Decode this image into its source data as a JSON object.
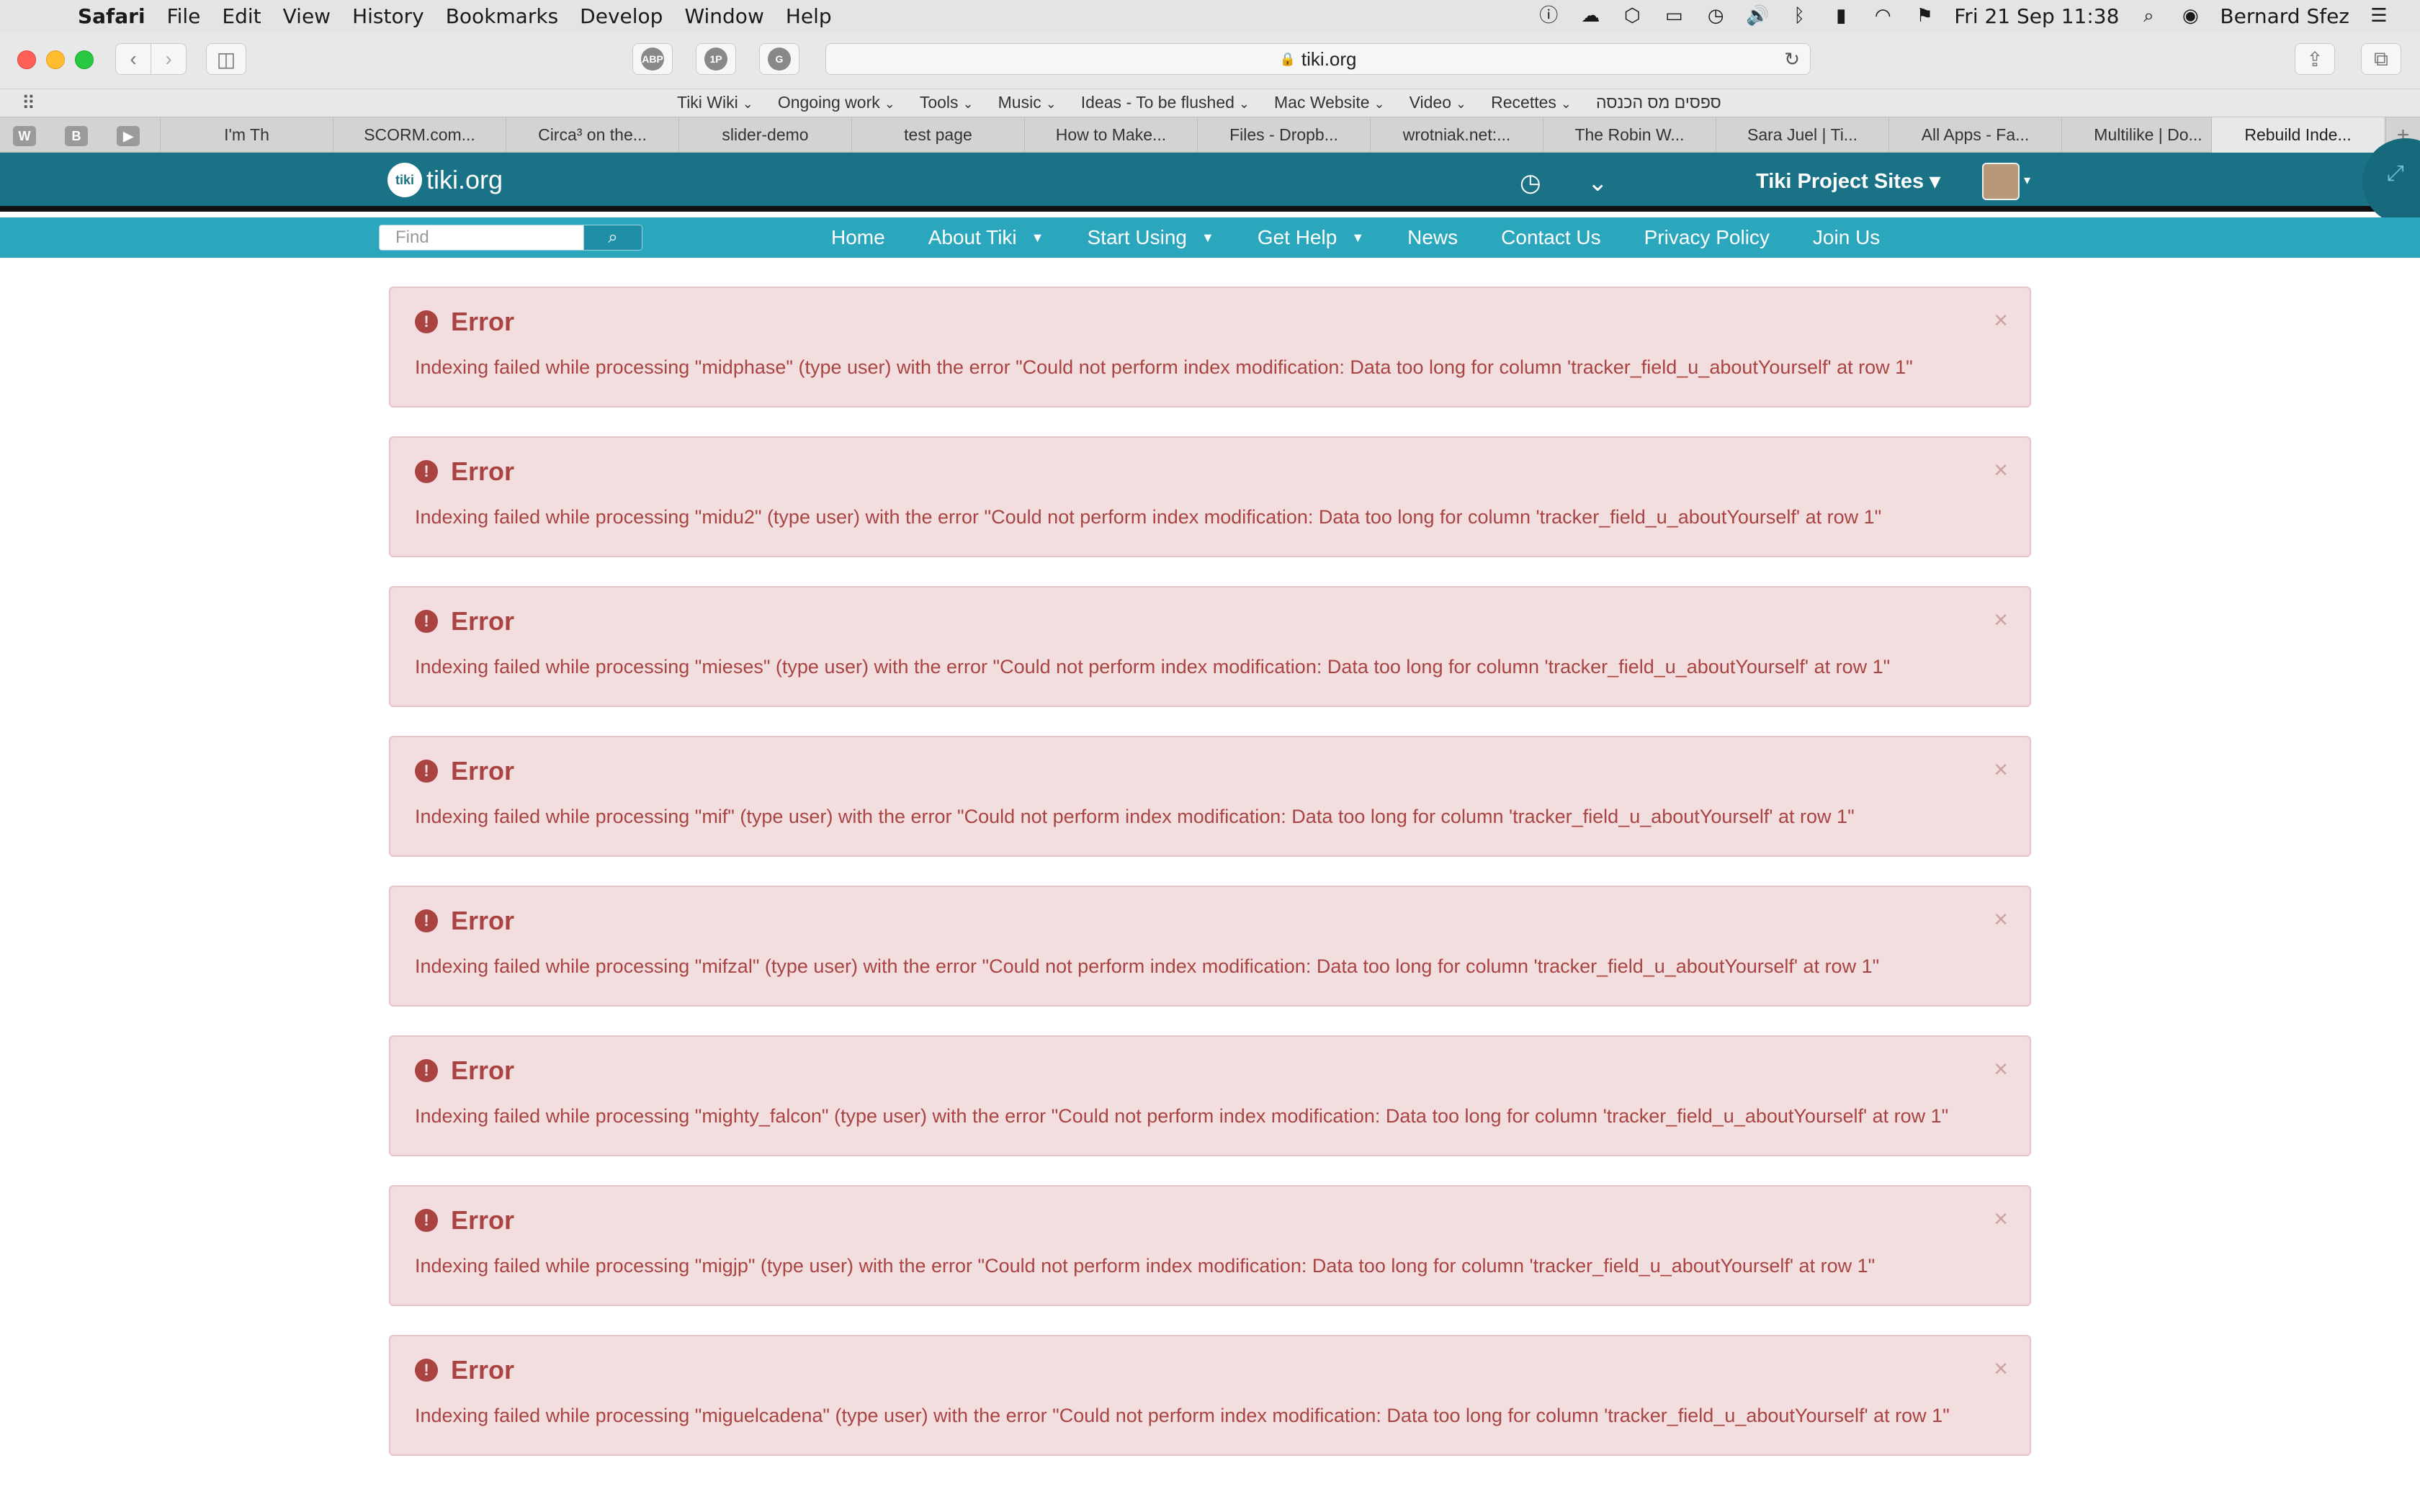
{
  "menubar": {
    "app": "Safari",
    "items": [
      "File",
      "Edit",
      "View",
      "History",
      "Bookmarks",
      "Develop",
      "Window",
      "Help"
    ],
    "datetime": "Fri 21 Sep  11:38",
    "user": "Bernard Sfez"
  },
  "toolbar": {
    "url": "tiki.org",
    "extensions": [
      "ABP",
      "1P",
      "G"
    ]
  },
  "favorites": [
    "Tiki Wiki",
    "Ongoing work",
    "Tools",
    "Music",
    "Ideas - To be flushed",
    "Mac Website",
    "Video",
    "Recettes",
    "ספסים מס הכנסה"
  ],
  "tabs": {
    "pinned": [
      "W",
      "B",
      "▶"
    ],
    "list": [
      "I'm Th",
      "SCORM.com...",
      "Circa³ on the...",
      "slider-demo",
      "test page",
      "How to Make...",
      "Files - Dropb...",
      "wrotniak.net:...",
      "The Robin W...",
      "Sara Juel | Ti...",
      "All Apps - Fa...",
      "Multilike | Do...",
      "Rebuild Inde..."
    ],
    "active_index": 12
  },
  "site": {
    "logo_mark": "tiki",
    "logo_text": "tiki.org",
    "project_sites": "Tiki Project Sites",
    "search_placeholder": "Find",
    "nav": [
      {
        "label": "Home",
        "dropdown": false
      },
      {
        "label": "About Tiki",
        "dropdown": true
      },
      {
        "label": "Start Using",
        "dropdown": true
      },
      {
        "label": "Get Help",
        "dropdown": true
      },
      {
        "label": "News",
        "dropdown": false
      },
      {
        "label": "Contact Us",
        "dropdown": false
      },
      {
        "label": "Privacy Policy",
        "dropdown": false
      },
      {
        "label": "Join Us",
        "dropdown": false
      }
    ]
  },
  "errors": [
    {
      "title": "Error",
      "message": "Indexing failed while processing \"midphase\" (type user) with the error \"Could not perform index modification: Data too long for column 'tracker_field_u_aboutYourself' at row 1\""
    },
    {
      "title": "Error",
      "message": "Indexing failed while processing \"midu2\" (type user) with the error \"Could not perform index modification: Data too long for column 'tracker_field_u_aboutYourself' at row 1\""
    },
    {
      "title": "Error",
      "message": "Indexing failed while processing \"mieses\" (type user) with the error \"Could not perform index modification: Data too long for column 'tracker_field_u_aboutYourself' at row 1\""
    },
    {
      "title": "Error",
      "message": "Indexing failed while processing \"mif\" (type user) with the error \"Could not perform index modification: Data too long for column 'tracker_field_u_aboutYourself' at row 1\""
    },
    {
      "title": "Error",
      "message": "Indexing failed while processing \"mifzal\" (type user) with the error \"Could not perform index modification: Data too long for column 'tracker_field_u_aboutYourself' at row 1\""
    },
    {
      "title": "Error",
      "message": "Indexing failed while processing \"mighty_falcon\" (type user) with the error \"Could not perform index modification: Data too long for column 'tracker_field_u_aboutYourself' at row 1\""
    },
    {
      "title": "Error",
      "message": "Indexing failed while processing \"migjp\" (type user) with the error \"Could not perform index modification: Data too long for column 'tracker_field_u_aboutYourself' at row 1\""
    },
    {
      "title": "Error",
      "message": "Indexing failed while processing \"miguelcadena\" (type user) with the error \"Could not perform index modification: Data too long for column 'tracker_field_u_aboutYourself' at row 1\""
    }
  ],
  "icons": {
    "error": "exclamation-circle-icon",
    "close": "close-icon"
  },
  "colors": {
    "header_bg": "#1a7287",
    "nav_bg": "#2aa6bd",
    "alert_bg": "#f2dede",
    "alert_text": "#a94442"
  }
}
